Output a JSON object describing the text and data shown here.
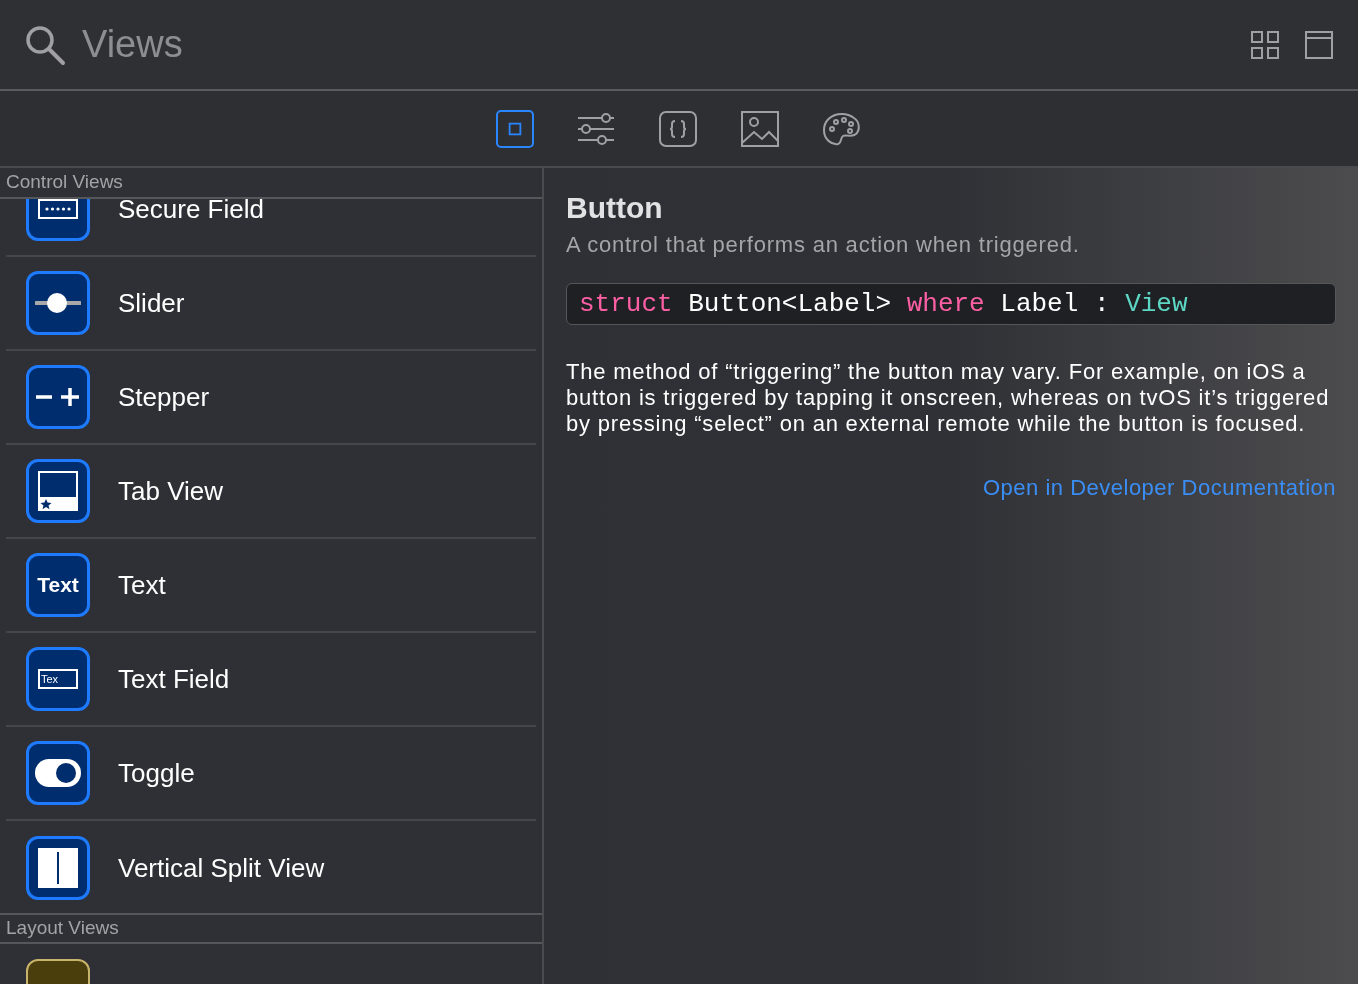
{
  "search": {
    "placeholder": "Views"
  },
  "view_toggles": [
    {
      "kind": "grid"
    },
    {
      "kind": "window"
    }
  ],
  "tabs": [
    {
      "kind": "square",
      "selected": true
    },
    {
      "kind": "sliders",
      "selected": false
    },
    {
      "kind": "braces",
      "selected": false
    },
    {
      "kind": "image",
      "selected": false
    },
    {
      "kind": "palette",
      "selected": false
    }
  ],
  "sections": [
    {
      "title": "Control Views",
      "items": [
        {
          "label": "Secure Field",
          "kind": "secure"
        },
        {
          "label": "Slider",
          "kind": "slider"
        },
        {
          "label": "Stepper",
          "kind": "stepper"
        },
        {
          "label": "Tab View",
          "kind": "tabview"
        },
        {
          "label": "Text",
          "kind": "text",
          "icon_text": "Text"
        },
        {
          "label": "Text Field",
          "kind": "textfield",
          "icon_text": "Tex"
        },
        {
          "label": "Toggle",
          "kind": "toggle"
        },
        {
          "label": "Vertical Split View",
          "kind": "vsplit"
        }
      ]
    },
    {
      "title": "Layout Views",
      "items": [
        {
          "kind": "layout"
        }
      ]
    }
  ],
  "detail": {
    "title": "Button",
    "subtitle": "A control that performs an action when triggered.",
    "declaration": [
      {
        "text": "struct",
        "kind": "keyword"
      },
      {
        "text": " Button<Label> ",
        "kind": "plain"
      },
      {
        "text": "where",
        "kind": "keyword"
      },
      {
        "text": " Label : ",
        "kind": "plain"
      },
      {
        "text": "View",
        "kind": "type"
      }
    ],
    "description": "The method of “triggering” the button may vary. For example, on iOS a button is triggered by tapping it onscreen, whereas on tvOS it’s triggered by pressing “select” on an external remote while the button is focused.",
    "link": "Open in Developer Documentation"
  }
}
